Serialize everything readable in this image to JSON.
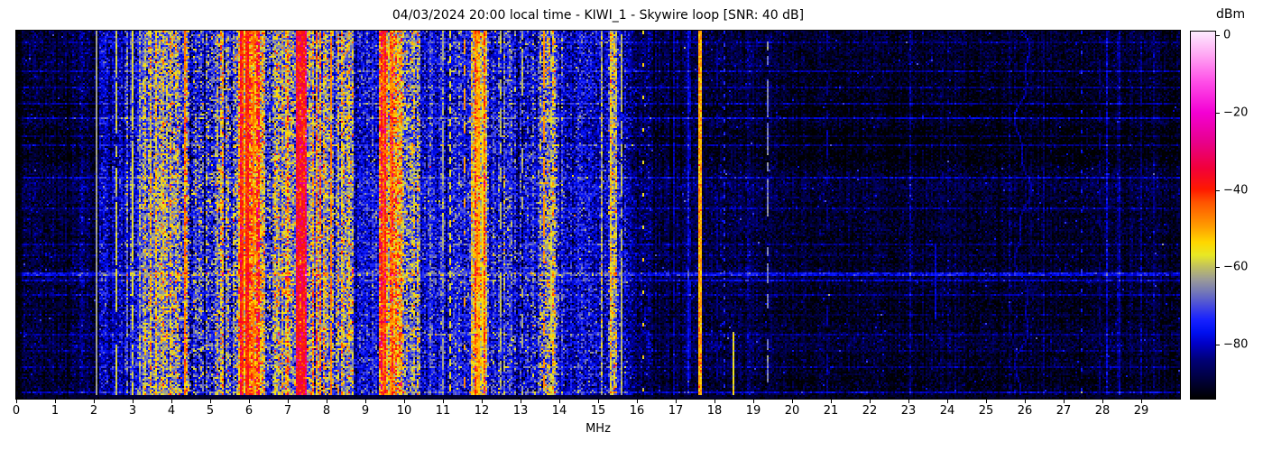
{
  "title": "04/03/2024 20:00 local time - KIWI_1 - Skywire loop [SNR: 40 dB]",
  "colorbar": {
    "label": "dBm",
    "tick_values": [
      0,
      -20,
      -40,
      -60,
      -80
    ],
    "tick_labels": [
      "0",
      "−20",
      "−40",
      "−60",
      "−80"
    ],
    "vmax": 1,
    "vmin": -94
  },
  "x_axis": {
    "label": "MHz",
    "tick_values": [
      0,
      1,
      2,
      3,
      4,
      5,
      6,
      7,
      8,
      9,
      10,
      11,
      12,
      13,
      14,
      15,
      16,
      17,
      18,
      19,
      20,
      21,
      22,
      23,
      24,
      25,
      26,
      27,
      28,
      29
    ],
    "min": 0,
    "max": 30
  },
  "chart_data": {
    "type": "heatmap",
    "title": "04/03/2024 20:00 local time - KIWI_1 - Skywire loop [SNR: 40 dB]",
    "xlabel": "MHz",
    "x_range": [
      0,
      30
    ],
    "value_label": "dBm",
    "value_range": [
      -94,
      1
    ],
    "colorbar_ticks": [
      0,
      -20,
      -40,
      -60,
      -80
    ],
    "legend_position": "right-colorbar",
    "grid": false,
    "colormap_stops": [
      [
        0.0,
        "#000000"
      ],
      [
        0.055,
        "#000040"
      ],
      [
        0.105,
        "#000078"
      ],
      [
        0.15,
        "#0000c8"
      ],
      [
        0.18,
        "#0010f0"
      ],
      [
        0.215,
        "#1822ff"
      ],
      [
        0.25,
        "#4448e0"
      ],
      [
        0.29,
        "#7478b8"
      ],
      [
        0.325,
        "#9c9c98"
      ],
      [
        0.36,
        "#c2c25e"
      ],
      [
        0.39,
        "#e8e826"
      ],
      [
        0.425,
        "#ffd800"
      ],
      [
        0.47,
        "#ff9c00"
      ],
      [
        0.535,
        "#ff5400"
      ],
      [
        0.57,
        "#ff1a00"
      ],
      [
        0.63,
        "#f2003c"
      ],
      [
        0.7,
        "#e8008c"
      ],
      [
        0.78,
        "#f400d4"
      ],
      [
        0.865,
        "#ff50e8"
      ],
      [
        0.94,
        "#ffaaf4"
      ],
      [
        1.0,
        "#fdeaff"
      ]
    ],
    "bands": [
      {
        "f0": 0.0,
        "f1": 0.12,
        "base": -93,
        "sig": 1.5,
        "stripe": 0.5,
        "stp": 0,
        "stg": 0,
        "sg": 0.3
      },
      {
        "f0": 0.12,
        "f1": 1.5,
        "base": -88.5,
        "sig": 3.5,
        "stripe": 1.5,
        "stp": 0.01,
        "stg": 4,
        "sg": 1.3
      },
      {
        "f0": 1.5,
        "f1": 1.88,
        "base": -85,
        "sig": 4,
        "stripe": 1.5,
        "stp": 0,
        "stg": 0,
        "sg": 1.2
      },
      {
        "f0": 1.88,
        "f1": 2.12,
        "base": -88,
        "sig": 3.5,
        "stripe": 1.2,
        "stp": 0,
        "stg": 0,
        "sg": 1.2
      },
      {
        "f0": 2.12,
        "f1": 2.78,
        "base": -80,
        "sig": 5,
        "stripe": 2,
        "stp": 0.02,
        "stg": 6,
        "sg": 1.0
      },
      {
        "f0": 2.78,
        "f1": 3.22,
        "base": -77,
        "sig": 6,
        "stripe": 3,
        "stp": 0.06,
        "stg": 9,
        "sg": 1.0
      },
      {
        "f0": 3.22,
        "f1": 3.95,
        "base": -65,
        "sig": 8,
        "stripe": 5,
        "stp": 0.15,
        "stg": 8,
        "sg": 0.7
      },
      {
        "f0": 3.95,
        "f1": 4.45,
        "base": -68,
        "sig": 9,
        "stripe": 6,
        "stp": 0.12,
        "stg": 9,
        "sg": 0.7
      },
      {
        "f0": 4.45,
        "f1": 5.3,
        "base": -73,
        "sig": 9,
        "stripe": 5,
        "stp": 0.1,
        "stg": 10,
        "sg": 0.8
      },
      {
        "f0": 5.3,
        "f1": 5.72,
        "base": -68,
        "sig": 9,
        "stripe": 5,
        "stp": 0.15,
        "stg": 8,
        "sg": 0.7
      },
      {
        "f0": 5.72,
        "f1": 6.25,
        "base": -50,
        "sig": 8,
        "stripe": 6,
        "stp": 0.3,
        "stg": 7,
        "sg": 0.5
      },
      {
        "f0": 6.25,
        "f1": 6.75,
        "base": -64,
        "sig": 9,
        "stripe": 6,
        "stp": 0.15,
        "stg": 8,
        "sg": 0.6
      },
      {
        "f0": 6.75,
        "f1": 7.18,
        "base": -60,
        "sig": 9,
        "stripe": 6,
        "stp": 0.2,
        "stg": 7,
        "sg": 0.6
      },
      {
        "f0": 7.18,
        "f1": 7.48,
        "base": -44,
        "sig": 7,
        "stripe": 4,
        "stp": 0.3,
        "stg": 5,
        "sg": 0.4
      },
      {
        "f0": 7.48,
        "f1": 8.05,
        "base": -62,
        "sig": 9,
        "stripe": 6,
        "stp": 0.2,
        "stg": 8,
        "sg": 0.6
      },
      {
        "f0": 8.05,
        "f1": 8.66,
        "base": -65,
        "sig": 9,
        "stripe": 6,
        "stp": 0.15,
        "stg": 8,
        "sg": 0.6
      },
      {
        "f0": 8.66,
        "f1": 9.33,
        "base": -77,
        "sig": 6,
        "stripe": 3,
        "stp": 0.02,
        "stg": 8,
        "sg": 0.9
      },
      {
        "f0": 9.33,
        "f1": 9.92,
        "base": -53,
        "sig": 9,
        "stripe": 6,
        "stp": 0.3,
        "stg": 7,
        "sg": 0.5
      },
      {
        "f0": 9.92,
        "f1": 10.4,
        "base": -65,
        "sig": 9,
        "stripe": 5,
        "stp": 0.15,
        "stg": 8,
        "sg": 0.7
      },
      {
        "f0": 10.4,
        "f1": 11.08,
        "base": -77,
        "sig": 6,
        "stripe": 3,
        "stp": 0.02,
        "stg": 8,
        "sg": 0.9
      },
      {
        "f0": 11.08,
        "f1": 11.72,
        "base": -75,
        "sig": 6.5,
        "stripe": 3,
        "stp": 0.03,
        "stg": 8,
        "sg": 0.9
      },
      {
        "f0": 11.72,
        "f1": 12.12,
        "base": -57,
        "sig": 7,
        "stripe": 5,
        "stp": 0.3,
        "stg": 6,
        "sg": 0.6
      },
      {
        "f0": 12.12,
        "f1": 13.48,
        "base": -75.5,
        "sig": 7,
        "stripe": 3.5,
        "stp": 0.04,
        "stg": 12,
        "sg": 0.9
      },
      {
        "f0": 13.48,
        "f1": 13.95,
        "base": -66,
        "sig": 9,
        "stripe": 5,
        "stp": 0.15,
        "stg": 8,
        "sg": 0.8
      },
      {
        "f0": 13.95,
        "f1": 15.22,
        "base": -78,
        "sig": 6,
        "stripe": 3,
        "stp": 0.03,
        "stg": 10,
        "sg": 0.9
      },
      {
        "f0": 15.22,
        "f1": 15.46,
        "base": -64,
        "sig": 8,
        "stripe": 4,
        "stp": 0.2,
        "stg": 7,
        "sg": 0.8
      },
      {
        "f0": 15.46,
        "f1": 15.75,
        "base": -78,
        "sig": 6,
        "stripe": 3,
        "stp": 0,
        "stg": 0,
        "sg": 0.9
      },
      {
        "f0": 15.75,
        "f1": 16.4,
        "base": -85,
        "sig": 4.5,
        "stripe": 2,
        "stp": 0.02,
        "stg": 5,
        "sg": 1.1
      },
      {
        "f0": 16.4,
        "f1": 19.3,
        "base": -88.5,
        "sig": 3.5,
        "stripe": 1.5,
        "stp": 0.02,
        "stg": 5,
        "sg": 1.3
      },
      {
        "f0": 19.3,
        "f1": 20.1,
        "base": -89,
        "sig": 3.3,
        "stripe": 1.5,
        "stp": 0.02,
        "stg": 5,
        "sg": 1.3
      },
      {
        "f0": 20.1,
        "f1": 30.01,
        "base": -90,
        "sig": 3.2,
        "stripe": 1.2,
        "stp": 0.02,
        "stg": 5,
        "sg": 1.4
      }
    ],
    "spectral_lines": [
      {
        "f": 2.05,
        "lv": -63,
        "w": 1,
        "st": "solid",
        "j": 1
      },
      {
        "f": 2.59,
        "lv": -59,
        "w": 1,
        "st": "flk",
        "p": 0.8
      },
      {
        "f": 3.01,
        "lv": -58,
        "w": 1,
        "st": "flk",
        "p": 0.8
      },
      {
        "f": 4.36,
        "lv": -47,
        "w": 1,
        "st": "flk",
        "p": 0.65
      },
      {
        "f": 5.82,
        "lv": -42,
        "w": 2,
        "st": "solid",
        "j": 3
      },
      {
        "f": 5.96,
        "lv": -40,
        "w": 2,
        "st": "solid",
        "j": 3
      },
      {
        "f": 6.1,
        "lv": -46,
        "w": 1,
        "st": "flk",
        "p": 0.8
      },
      {
        "f": 7.25,
        "lv": -40,
        "w": 2,
        "st": "solid",
        "j": 3
      },
      {
        "f": 7.38,
        "lv": -41,
        "w": 2,
        "st": "solid",
        "j": 3
      },
      {
        "f": 8.13,
        "lv": -47,
        "w": 1,
        "st": "flk",
        "p": 0.7
      },
      {
        "f": 9.5,
        "lv": -45,
        "w": 2,
        "st": "solid",
        "j": 3
      },
      {
        "f": 9.66,
        "lv": -48,
        "w": 2,
        "st": "flk",
        "p": 0.8
      },
      {
        "f": 11.02,
        "lv": -63,
        "w": 1,
        "st": "flk",
        "p": 0.6
      },
      {
        "f": 11.2,
        "lv": -56,
        "w": 1,
        "st": "dash",
        "on": 4,
        "off": 3
      },
      {
        "f": 11.56,
        "lv": -49,
        "w": 1,
        "st": "flk",
        "p": 0.5
      },
      {
        "f": 11.9,
        "lv": -52,
        "w": 2,
        "st": "flk",
        "p": 0.75
      },
      {
        "f": 12.02,
        "lv": -55,
        "w": 1,
        "st": "flk",
        "p": 0.7
      },
      {
        "f": 12.5,
        "lv": -61,
        "w": 1,
        "st": "flk",
        "p": 0.5
      },
      {
        "f": 13.06,
        "lv": -62,
        "w": 1,
        "st": "flk",
        "p": 0.4
      },
      {
        "f": 13.62,
        "lv": -48,
        "w": 1,
        "st": "flk",
        "p": 0.6
      },
      {
        "f": 13.78,
        "lv": -59,
        "w": 1,
        "st": "flk",
        "p": 0.6
      },
      {
        "f": 15.34,
        "lv": -59,
        "w": 1,
        "st": "flk",
        "p": 0.8
      },
      {
        "f": 15.6,
        "lv": -61,
        "w": 1,
        "st": "flk",
        "p": 0.7
      },
      {
        "f": 16.16,
        "lv": -54,
        "w": 1,
        "st": "dash",
        "on": 2,
        "off": 16
      },
      {
        "f": 16.97,
        "lv": -82,
        "w": 1,
        "st": "flk",
        "p": 0.6
      },
      {
        "f": 17.36,
        "lv": -80,
        "w": 2,
        "st": "flk",
        "p": 0.5
      },
      {
        "f": 17.65,
        "lv": -50,
        "w": 2,
        "st": "solid",
        "j": 3
      },
      {
        "f": 18.06,
        "lv": -83,
        "w": 1,
        "st": "flk",
        "p": 0.5
      },
      {
        "f": 18.24,
        "lv": -74,
        "w": 1,
        "st": "dash",
        "on": 2,
        "off": 5
      },
      {
        "f": 18.51,
        "lv": -56,
        "w": 1,
        "st": "part",
        "y0": 0.82,
        "y1": 0.995
      },
      {
        "f": 19.37,
        "lv": -66,
        "w": 1,
        "st": "flk",
        "p": 0.55
      },
      {
        "f": 20.9,
        "lv": -83,
        "w": 1,
        "st": "flk",
        "p": 0.5
      },
      {
        "f": 23.7,
        "lv": -79,
        "w": 1,
        "st": "part",
        "y0": 0.58,
        "y1": 0.78
      },
      {
        "f": 27.47,
        "lv": -76,
        "w": 1,
        "st": "dash",
        "on": 2,
        "off": 9
      },
      {
        "f": 27.93,
        "lv": -84,
        "w": 1,
        "st": "flk",
        "p": 0.5
      }
    ],
    "time_streaks": [
      {
        "y": 0.027,
        "r": 1,
        "b": 4
      },
      {
        "y": 0.108,
        "r": 1,
        "b": 6
      },
      {
        "y": 0.154,
        "r": 1,
        "b": 5
      },
      {
        "y": 0.194,
        "r": 1,
        "b": 7
      },
      {
        "y": 0.235,
        "r": 1,
        "b": 8
      },
      {
        "y": 0.284,
        "r": 1,
        "b": 4
      },
      {
        "y": 0.311,
        "r": 1,
        "b": 6
      },
      {
        "y": 0.397,
        "r": 1,
        "b": 7
      },
      {
        "y": 0.48,
        "r": 1,
        "b": 4
      },
      {
        "y": 0.578,
        "r": 1,
        "b": 4
      },
      {
        "y": 0.61,
        "r": 1,
        "b": 3
      },
      {
        "y": 0.655,
        "r": 2,
        "b": 9
      },
      {
        "y": 0.676,
        "r": 1,
        "b": 6
      },
      {
        "y": 0.716,
        "r": 1,
        "b": 5
      },
      {
        "y": 0.769,
        "r": 1,
        "b": 3
      },
      {
        "y": 0.824,
        "r": 1,
        "b": 4
      },
      {
        "y": 0.87,
        "r": 1,
        "b": 3
      },
      {
        "y": 0.914,
        "r": 1,
        "b": 4
      },
      {
        "y": 0.98,
        "r": 1,
        "b": 7
      }
    ],
    "chirp": {
      "f": 25.92,
      "a1": 0.16,
      "p1": 11,
      "a2": 0.07,
      "p2": 4.3,
      "lv": -82
    }
  }
}
